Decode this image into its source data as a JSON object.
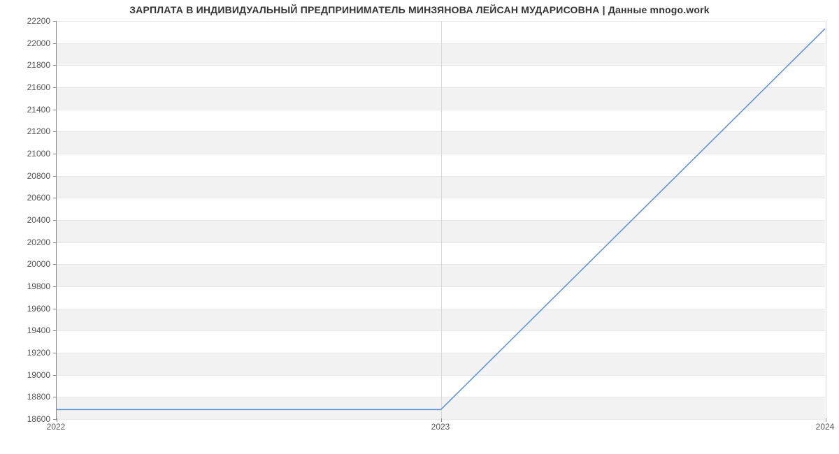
{
  "chart_data": {
    "type": "line",
    "title": "ЗАРПЛАТА В ИНДИВИДУАЛЬНЫЙ ПРЕДПРИНИМАТЕЛЬ МИНЗЯНОВА ЛЕЙСАН МУДАРИСОВНА | Данные mnogo.work",
    "xlabel": "",
    "ylabel": "",
    "x_categories": [
      "2022",
      "2023",
      "2024"
    ],
    "x_numeric": [
      2022,
      2023,
      2024
    ],
    "series": [
      {
        "name": "salary",
        "values": [
          18680,
          18680,
          22130
        ]
      }
    ],
    "xlim": [
      2022,
      2024
    ],
    "ylim": [
      18600,
      22200
    ],
    "yticks": [
      18600,
      18800,
      19000,
      19200,
      19400,
      19600,
      19800,
      20000,
      20200,
      20400,
      20600,
      20800,
      21000,
      21200,
      21400,
      21600,
      21800,
      22000,
      22200
    ],
    "xticks": [
      2022,
      2023,
      2024
    ],
    "grid": {
      "y": true,
      "x": true,
      "alternating_bands": true
    },
    "line_color": "#5b8fd6"
  }
}
